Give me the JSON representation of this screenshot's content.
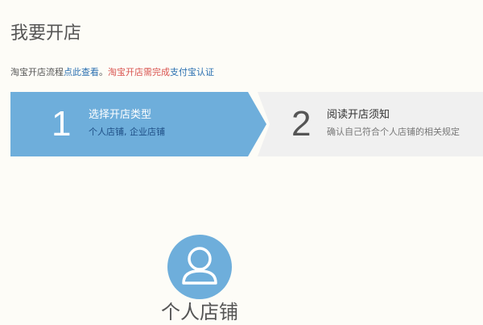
{
  "page": {
    "title": "我要开店"
  },
  "notice": {
    "text_before": "淘宝开店流程",
    "link_view": "点此查看",
    "separator": "。",
    "warn_text": "淘宝开店需完成",
    "link_auth": "支付宝认证"
  },
  "steps": [
    {
      "number": "1",
      "title": "选择开店类型",
      "desc": "个人店铺, 企业店铺",
      "state": "active",
      "color": "#6eaedb"
    },
    {
      "number": "2",
      "title": "阅读开店须知",
      "desc": "确认自己符合个人店铺的相关规定",
      "state": "inactive",
      "color": "#f0f0f0"
    }
  ],
  "shop_options": [
    {
      "label": "个人店铺",
      "icon": "person-icon",
      "color": "#6eaedb"
    }
  ]
}
